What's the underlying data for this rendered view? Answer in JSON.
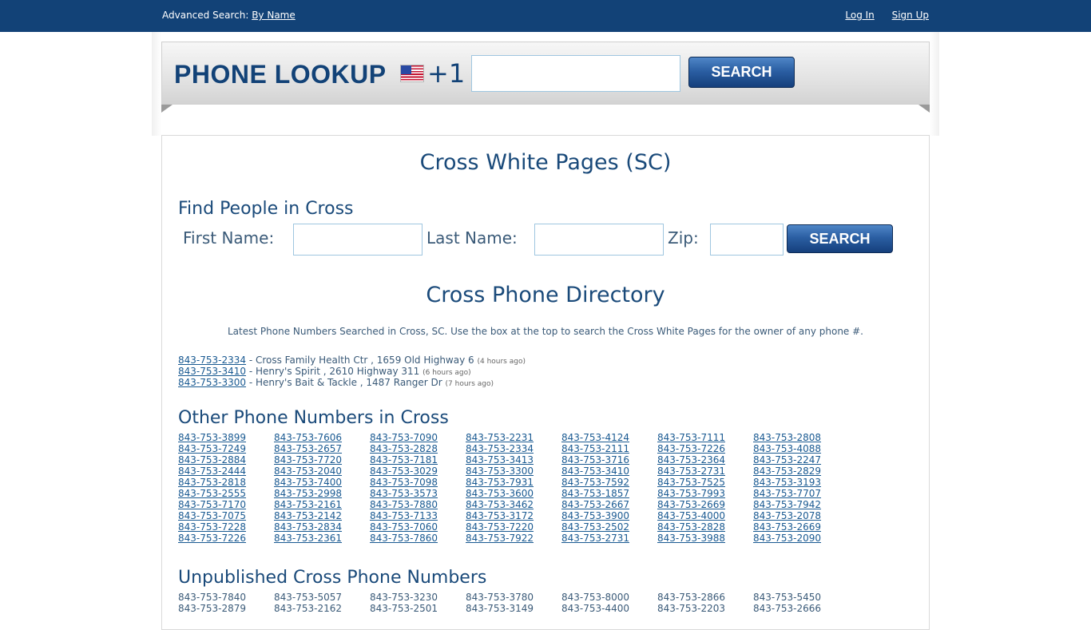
{
  "topbar": {
    "advanced_label": "Advanced Search:",
    "by_name": "By Name",
    "login": "Log In",
    "signup": "Sign Up"
  },
  "header": {
    "brand": "PHONE LOOKUP",
    "country_code": "+1",
    "search_label": "SEARCH",
    "phone_value": ""
  },
  "page": {
    "title": "Cross White Pages (SC)",
    "find_heading": "Find People in Cross",
    "first_name_label": "First Name:",
    "last_name_label": "Last Name:",
    "zip_label": "Zip:",
    "search_label": "SEARCH",
    "directory_title": "Cross Phone Directory",
    "intro": "Latest Phone Numbers Searched in Cross, SC. Use the box at the top to search the Cross White Pages for the owner of any phone #.",
    "recent": [
      {
        "number": "843-753-2334",
        "desc": " - Cross Family Health Ctr , 1659 Old Highway 6 ",
        "ago": "(4 hours ago)"
      },
      {
        "number": "843-753-3410",
        "desc": " - Henry's Spirit , 2610 Highway 311 ",
        "ago": "(6 hours ago)"
      },
      {
        "number": "843-753-3300",
        "desc": " - Henry's Bait & Tackle , 1487 Ranger Dr ",
        "ago": "(7 hours ago)"
      }
    ],
    "other_heading": "Other Phone Numbers in Cross",
    "other_numbers": [
      "843-753-3899",
      "843-753-7606",
      "843-753-7090",
      "843-753-2231",
      "843-753-4124",
      "843-753-7111",
      "843-753-2808",
      "843-753-7249",
      "843-753-2657",
      "843-753-2828",
      "843-753-2334",
      "843-753-2111",
      "843-753-7226",
      "843-753-4088",
      "843-753-2884",
      "843-753-7720",
      "843-753-7181",
      "843-753-3413",
      "843-753-3716",
      "843-753-2364",
      "843-753-2247",
      "843-753-2444",
      "843-753-2040",
      "843-753-3029",
      "843-753-3300",
      "843-753-3410",
      "843-753-2731",
      "843-753-2829",
      "843-753-2818",
      "843-753-7400",
      "843-753-7098",
      "843-753-7931",
      "843-753-7592",
      "843-753-7525",
      "843-753-3193",
      "843-753-2555",
      "843-753-2998",
      "843-753-3573",
      "843-753-3600",
      "843-753-1857",
      "843-753-7993",
      "843-753-7707",
      "843-753-7170",
      "843-753-2161",
      "843-753-7880",
      "843-753-3462",
      "843-753-2667",
      "843-753-2669",
      "843-753-7942",
      "843-753-7075",
      "843-753-2142",
      "843-753-7133",
      "843-753-3172",
      "843-753-3900",
      "843-753-4000",
      "843-753-2078",
      "843-753-7228",
      "843-753-2834",
      "843-753-7060",
      "843-753-7220",
      "843-753-2502",
      "843-753-2828",
      "843-753-2669",
      "843-753-7226",
      "843-753-2361",
      "843-753-7860",
      "843-753-7922",
      "843-753-2731",
      "843-753-3988",
      "843-753-2090"
    ],
    "unpublished_heading": "Unpublished Cross Phone Numbers",
    "unpublished_numbers": [
      "843-753-7840",
      "843-753-5057",
      "843-753-3230",
      "843-753-3780",
      "843-753-8000",
      "843-753-2866",
      "843-753-5450",
      "843-753-2879",
      "843-753-2162",
      "843-753-2501",
      "843-753-3149",
      "843-753-4400",
      "843-753-2203",
      "843-753-2666"
    ]
  },
  "colors": {
    "topbar": "#124277",
    "heading": "#1a4a7a",
    "link": "#1a5a92",
    "button": "#2b5fa3"
  }
}
